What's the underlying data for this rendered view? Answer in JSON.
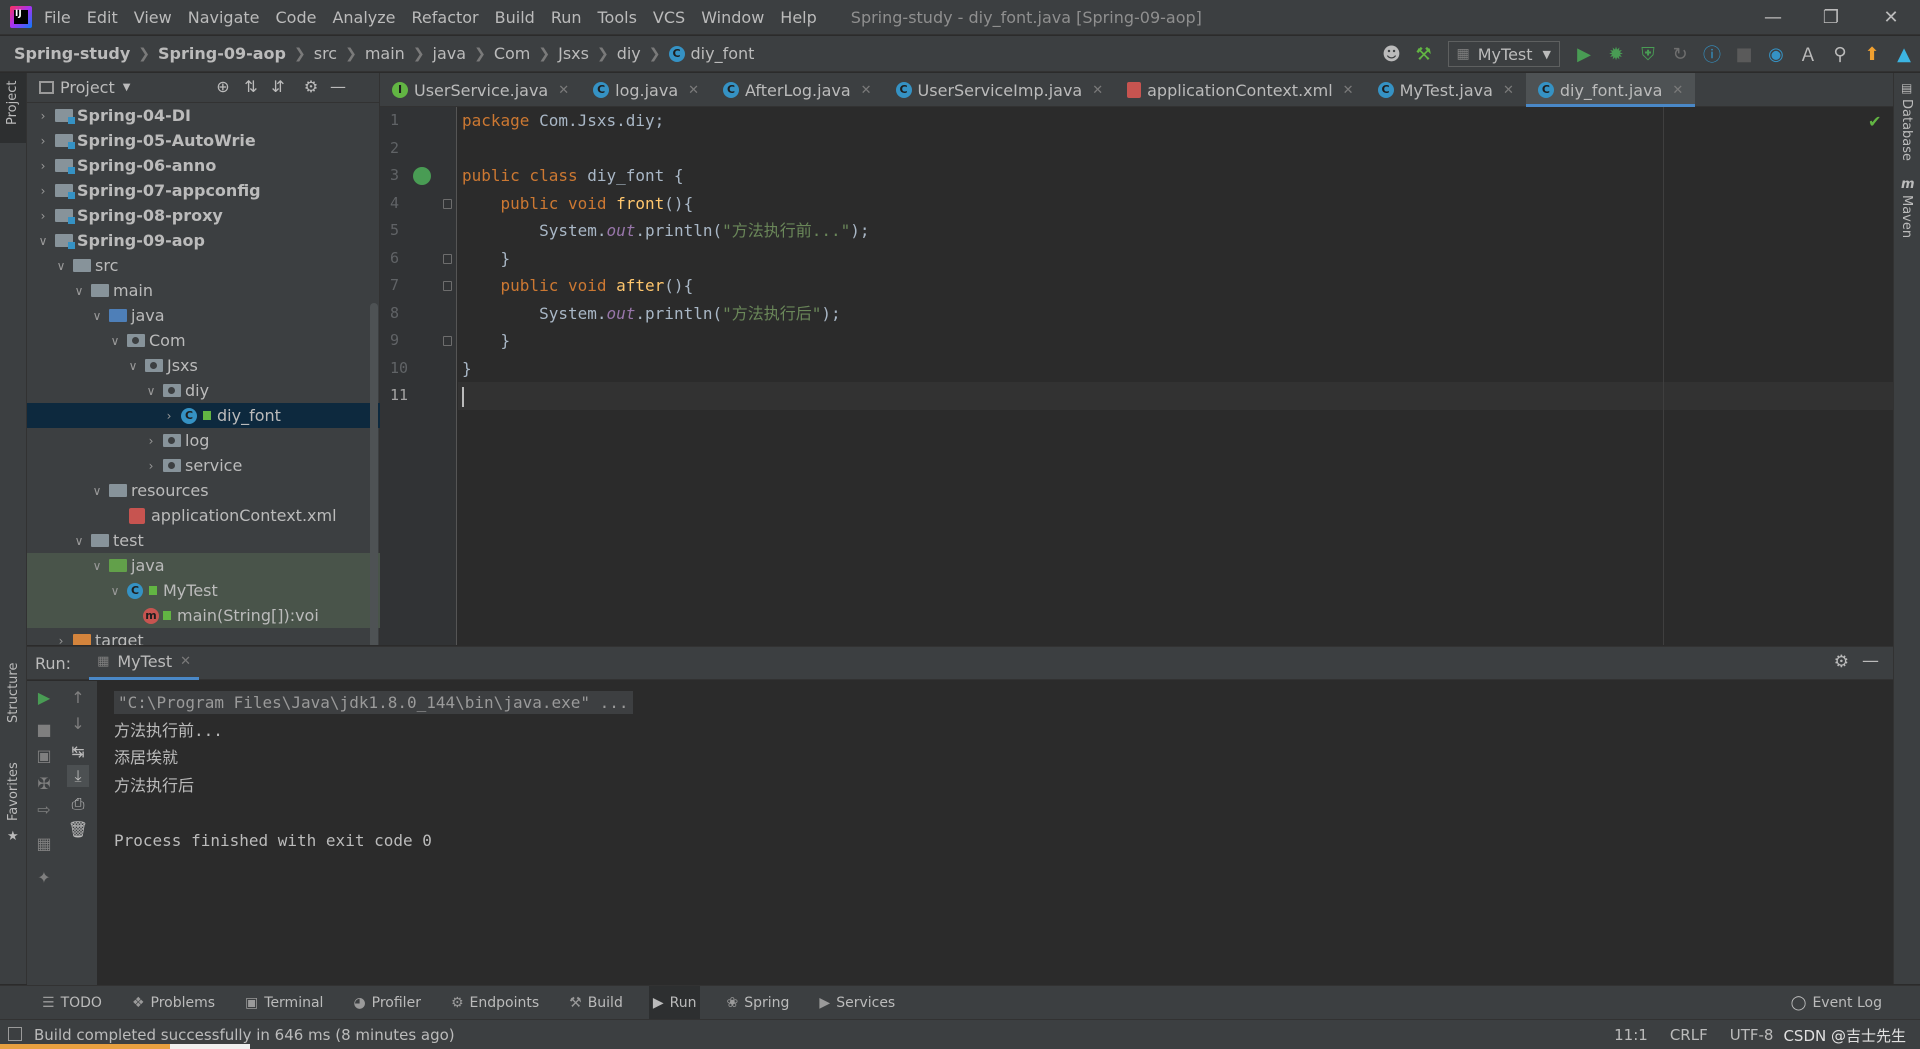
{
  "menu": {
    "items": [
      "File",
      "Edit",
      "View",
      "Navigate",
      "Code",
      "Analyze",
      "Refactor",
      "Build",
      "Run",
      "Tools",
      "VCS",
      "Window",
      "Help"
    ],
    "window_title": "Spring-study - diy_font.java [Spring-09-aop]"
  },
  "breadcrumb": {
    "items": [
      "Spring-study",
      "Spring-09-aop",
      "src",
      "main",
      "java",
      "Com",
      "Jsxs",
      "diy",
      "diy_font"
    ]
  },
  "toolbar": {
    "run_config": "MyTest"
  },
  "project_panel": {
    "title": "Project",
    "tree": [
      {
        "label": "Spring-04-DI",
        "depth": 1,
        "arrow": ">",
        "icon": "module-folder",
        "bold": true
      },
      {
        "label": "Spring-05-AutoWrie",
        "depth": 1,
        "arrow": ">",
        "icon": "module-folder",
        "bold": true
      },
      {
        "label": "Spring-06-anno",
        "depth": 1,
        "arrow": ">",
        "icon": "module-folder",
        "bold": true
      },
      {
        "label": "Spring-07-appconfig",
        "depth": 1,
        "arrow": ">",
        "icon": "module-folder",
        "bold": true
      },
      {
        "label": "Spring-08-proxy",
        "depth": 1,
        "arrow": ">",
        "icon": "module-folder",
        "bold": true
      },
      {
        "label": "Spring-09-aop",
        "depth": 1,
        "arrow": "v",
        "icon": "module-folder",
        "bold": true
      },
      {
        "label": "src",
        "depth": 2,
        "arrow": "v",
        "icon": "folder"
      },
      {
        "label": "main",
        "depth": 3,
        "arrow": "v",
        "icon": "folder"
      },
      {
        "label": "java",
        "depth": 4,
        "arrow": "v",
        "icon": "source-folder"
      },
      {
        "label": "Com",
        "depth": 5,
        "arrow": "v",
        "icon": "package-folder"
      },
      {
        "label": "Jsxs",
        "depth": 6,
        "arrow": "v",
        "icon": "package-folder"
      },
      {
        "label": "diy",
        "depth": 7,
        "arrow": "v",
        "icon": "package-folder"
      },
      {
        "label": "diy_font",
        "depth": 8,
        "arrow": ">",
        "icon": "class",
        "selected": true
      },
      {
        "label": "log",
        "depth": 7,
        "arrow": ">",
        "icon": "package-folder"
      },
      {
        "label": "service",
        "depth": 7,
        "arrow": ">",
        "icon": "package-folder"
      },
      {
        "label": "resources",
        "depth": 4,
        "arrow": "v",
        "icon": "resources-folder"
      },
      {
        "label": "applicationContext.xml",
        "depth": 5,
        "arrow": "",
        "icon": "xml-file"
      },
      {
        "label": "test",
        "depth": 3,
        "arrow": "v",
        "icon": "folder"
      },
      {
        "label": "java",
        "depth": 4,
        "arrow": "v",
        "icon": "test-folder",
        "test": true
      },
      {
        "label": "MyTest",
        "depth": 5,
        "arrow": "v",
        "icon": "class",
        "test": true
      },
      {
        "label": "main(String[]):voi",
        "depth": 6,
        "arrow": "",
        "icon": "method",
        "test": true
      },
      {
        "label": "target",
        "depth": 2,
        "arrow": ">",
        "icon": "target-folder"
      }
    ]
  },
  "editor": {
    "tabs": [
      {
        "label": "UserService.java",
        "icon": "interface-icon"
      },
      {
        "label": "log.java",
        "icon": "class-icon"
      },
      {
        "label": "AfterLog.java",
        "icon": "class-icon"
      },
      {
        "label": "UserServiceImp.java",
        "icon": "class-icon"
      },
      {
        "label": "applicationContext.xml",
        "icon": "xml-icon"
      },
      {
        "label": "MyTest.java",
        "icon": "class-icon"
      },
      {
        "label": "diy_font.java",
        "icon": "class-icon",
        "active": true
      }
    ],
    "line_numbers": [
      "1",
      "2",
      "3",
      "4",
      "5",
      "6",
      "7",
      "8",
      "9",
      "10",
      "11"
    ],
    "code": {
      "l1_kw": "package ",
      "l1_rest": "Com.Jsxs.diy;",
      "l3_kw": "public class ",
      "l3_rest": "diy_font {",
      "l4_kw": "    public void ",
      "l4_fn": "front",
      "l4_rest": "(){",
      "l5_a": "        System.",
      "l5_field": "out",
      "l5_b": ".println(",
      "l5_str": "\"方法执行前...\"",
      "l5_c": ");",
      "l6": "    }",
      "l7_kw": "    public void ",
      "l7_fn": "after",
      "l7_rest": "(){",
      "l8_a": "        System.",
      "l8_field": "out",
      "l8_b": ".println(",
      "l8_str": "\"方法执行后\"",
      "l8_c": ");",
      "l9": "    }",
      "l10": "}"
    }
  },
  "run_panel": {
    "label": "Run:",
    "tab": "MyTest",
    "console": {
      "cmd": "\"C:\\Program Files\\Java\\jdk1.8.0_144\\bin\\java.exe\" ...",
      "line1": "方法执行前...",
      "line2": "添居埃就",
      "line3": "方法执行后",
      "line4": "Process finished with exit code 0"
    }
  },
  "bottom_tools": {
    "items": [
      "TODO",
      "Problems",
      "Terminal",
      "Profiler",
      "Endpoints",
      "Build",
      "Run",
      "Spring",
      "Services"
    ],
    "event_log": "Event Log"
  },
  "status_bar": {
    "message": "Build completed successfully in 646 ms (8 minutes ago)",
    "position": "11:1",
    "line_sep": "CRLF",
    "encoding": "UTF-8",
    "watermark": "CSDN @吉士先生"
  },
  "side_labels": {
    "project": "Project",
    "structure": "Structure",
    "favorites": "Favorites",
    "database": "Database",
    "maven": "Maven"
  },
  "colors": {
    "accent": "#4a88c7",
    "keyword": "#cc7832",
    "function": "#ffc66d",
    "string": "#6a8759",
    "field": "#9876aa"
  }
}
